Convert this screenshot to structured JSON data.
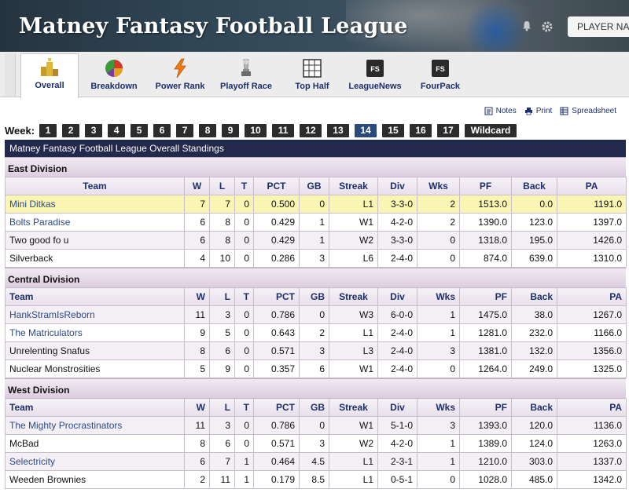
{
  "header": {
    "title": "Matney Fantasy Football League",
    "player_search_placeholder": "PLAYER NA"
  },
  "tabs": [
    {
      "label": "Overall",
      "icon": "overall-icon",
      "active": true
    },
    {
      "label": "Breakdown",
      "icon": "breakdown-icon",
      "active": false
    },
    {
      "label": "Power Rank",
      "icon": "power-rank-icon",
      "active": false
    },
    {
      "label": "Playoff Race",
      "icon": "playoff-race-icon",
      "active": false
    },
    {
      "label": "Top Half",
      "icon": "top-half-icon",
      "active": false
    },
    {
      "label": "LeagueNews",
      "icon": "league-news-icon",
      "active": false
    },
    {
      "label": "FourPack",
      "icon": "fourpack-icon",
      "active": false
    }
  ],
  "actions": {
    "notes": "Notes",
    "print": "Print",
    "spreadsheet": "Spreadsheet"
  },
  "week": {
    "label": "Week:",
    "weeks": [
      "1",
      "2",
      "3",
      "4",
      "5",
      "6",
      "7",
      "8",
      "9",
      "10",
      "11",
      "12",
      "13",
      "14",
      "15",
      "16",
      "17",
      "Wildcard"
    ],
    "selected": "14"
  },
  "standings": {
    "title": "Matney Fantasy Football League Overall Standings",
    "columns": [
      "Team",
      "W",
      "L",
      "T",
      "PCT",
      "GB",
      "Streak",
      "Div",
      "Wks",
      "PF",
      "Back",
      "PA"
    ],
    "divisions": [
      {
        "name": "East Division",
        "rows": [
          {
            "team": "Mini Ditkas",
            "link": true,
            "highlight": true,
            "cells": [
              "7",
              "7",
              "0",
              "0.500",
              "0",
              "L1",
              "3-3-0",
              "2",
              "1513.0",
              "0.0",
              "1191.0"
            ]
          },
          {
            "team": "Bolts Paradise",
            "link": true,
            "highlight": false,
            "cells": [
              "6",
              "8",
              "0",
              "0.429",
              "1",
              "W1",
              "4-2-0",
              "2",
              "1390.0",
              "123.0",
              "1397.0"
            ]
          },
          {
            "team": "Two good fo u",
            "link": false,
            "highlight": false,
            "cells": [
              "6",
              "8",
              "0",
              "0.429",
              "1",
              "W2",
              "3-3-0",
              "0",
              "1318.0",
              "195.0",
              "1426.0"
            ]
          },
          {
            "team": "Silverback",
            "link": false,
            "highlight": false,
            "cells": [
              "4",
              "10",
              "0",
              "0.286",
              "3",
              "L6",
              "2-4-0",
              "0",
              "874.0",
              "639.0",
              "1310.0"
            ]
          }
        ]
      },
      {
        "name": "Central Division",
        "rows": [
          {
            "team": "HankStramIsReborn",
            "link": true,
            "highlight": false,
            "cells": [
              "11",
              "3",
              "0",
              "0.786",
              "0",
              "W3",
              "6-0-0",
              "1",
              "1475.0",
              "38.0",
              "1267.0"
            ]
          },
          {
            "team": "The Matriculators",
            "link": true,
            "highlight": false,
            "cells": [
              "9",
              "5",
              "0",
              "0.643",
              "2",
              "L1",
              "2-4-0",
              "1",
              "1281.0",
              "232.0",
              "1166.0"
            ]
          },
          {
            "team": "Unrelenting Snafus",
            "link": false,
            "highlight": false,
            "cells": [
              "8",
              "6",
              "0",
              "0.571",
              "3",
              "L3",
              "2-4-0",
              "3",
              "1381.0",
              "132.0",
              "1356.0"
            ]
          },
          {
            "team": "Nuclear Monstrosities",
            "link": false,
            "highlight": false,
            "cells": [
              "5",
              "9",
              "0",
              "0.357",
              "6",
              "W1",
              "2-4-0",
              "0",
              "1264.0",
              "249.0",
              "1325.0"
            ]
          }
        ]
      },
      {
        "name": "West Division",
        "rows": [
          {
            "team": "The Mighty Procrastinators",
            "link": true,
            "highlight": false,
            "cells": [
              "11",
              "3",
              "0",
              "0.786",
              "0",
              "W1",
              "5-1-0",
              "3",
              "1393.0",
              "120.0",
              "1136.0"
            ]
          },
          {
            "team": "McBad",
            "link": false,
            "highlight": false,
            "cells": [
              "8",
              "6",
              "0",
              "0.571",
              "3",
              "W2",
              "4-2-0",
              "1",
              "1389.0",
              "124.0",
              "1263.0"
            ]
          },
          {
            "team": "Selectricity",
            "link": true,
            "highlight": false,
            "cells": [
              "6",
              "7",
              "1",
              "0.464",
              "4.5",
              "L1",
              "2-3-1",
              "1",
              "1210.0",
              "303.0",
              "1337.0"
            ]
          },
          {
            "team": "Weeden Brownies",
            "link": false,
            "highlight": false,
            "cells": [
              "2",
              "11",
              "1",
              "0.179",
              "8.5",
              "L1",
              "0-5-1",
              "0",
              "1028.0",
              "485.0",
              "1342.0"
            ]
          }
        ]
      }
    ]
  }
}
